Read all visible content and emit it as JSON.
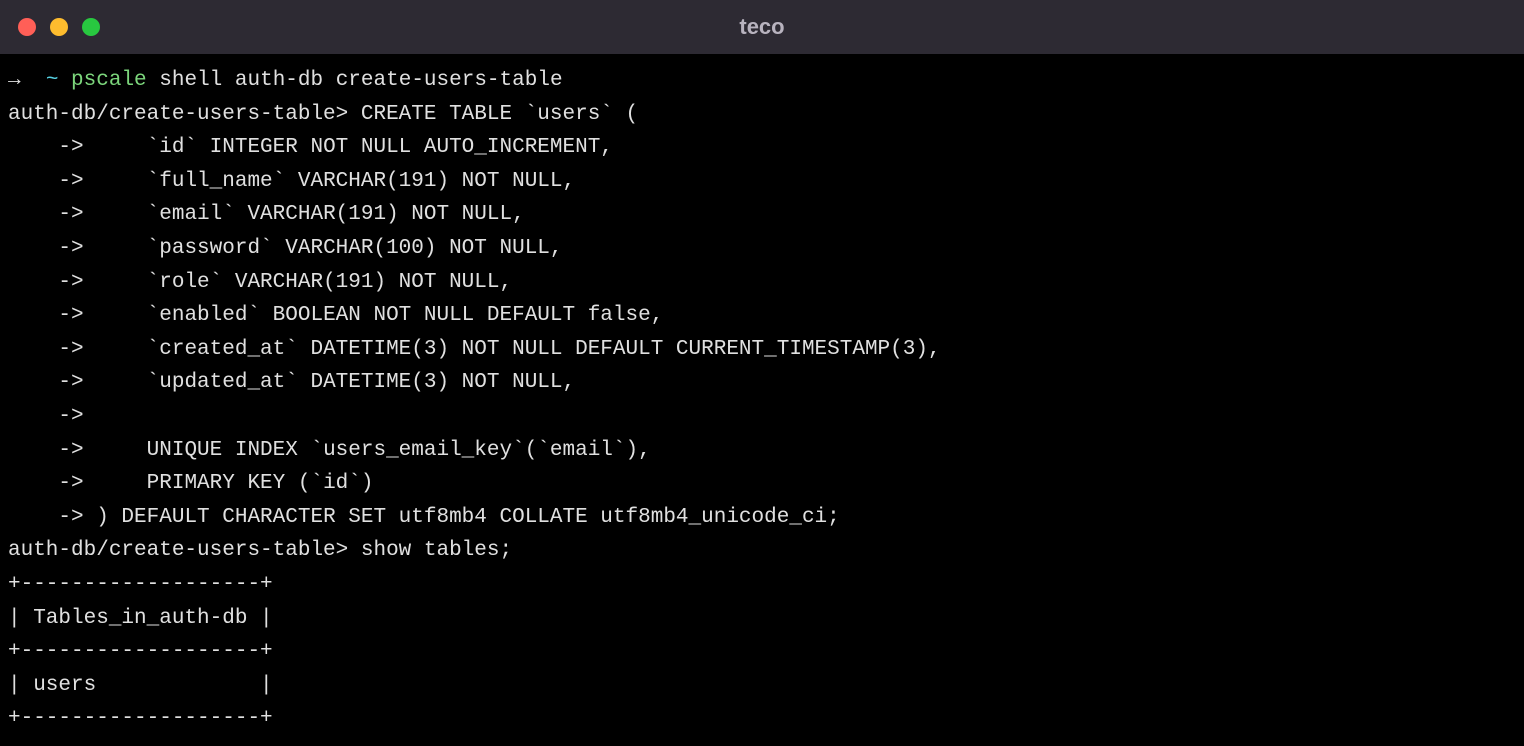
{
  "window": {
    "title": "teco"
  },
  "terminal": {
    "shell_arrow": "→",
    "shell_tilde": "~",
    "shell_pscale": "pscale",
    "shell_command": " shell auth-db create-users-table",
    "prompt": "auth-db/create-users-table>",
    "sql_create": " CREATE TABLE `users` (",
    "cont_prefix": "    ->",
    "sql_lines": [
      "     `id` INTEGER NOT NULL AUTO_INCREMENT,",
      "     `full_name` VARCHAR(191) NOT NULL,",
      "     `email` VARCHAR(191) NOT NULL,",
      "     `password` VARCHAR(100) NOT NULL,",
      "     `role` VARCHAR(191) NOT NULL,",
      "     `enabled` BOOLEAN NOT NULL DEFAULT false,",
      "     `created_at` DATETIME(3) NOT NULL DEFAULT CURRENT_TIMESTAMP(3),",
      "     `updated_at` DATETIME(3) NOT NULL,",
      "",
      "     UNIQUE INDEX `users_email_key`(`email`),",
      "     PRIMARY KEY (`id`)",
      " ) DEFAULT CHARACTER SET utf8mb4 COLLATE utf8mb4_unicode_ci;"
    ],
    "show_tables_cmd": " show tables;",
    "table_border": "+-------------------+",
    "table_header": "| Tables_in_auth-db |",
    "table_row": "| users             |"
  }
}
